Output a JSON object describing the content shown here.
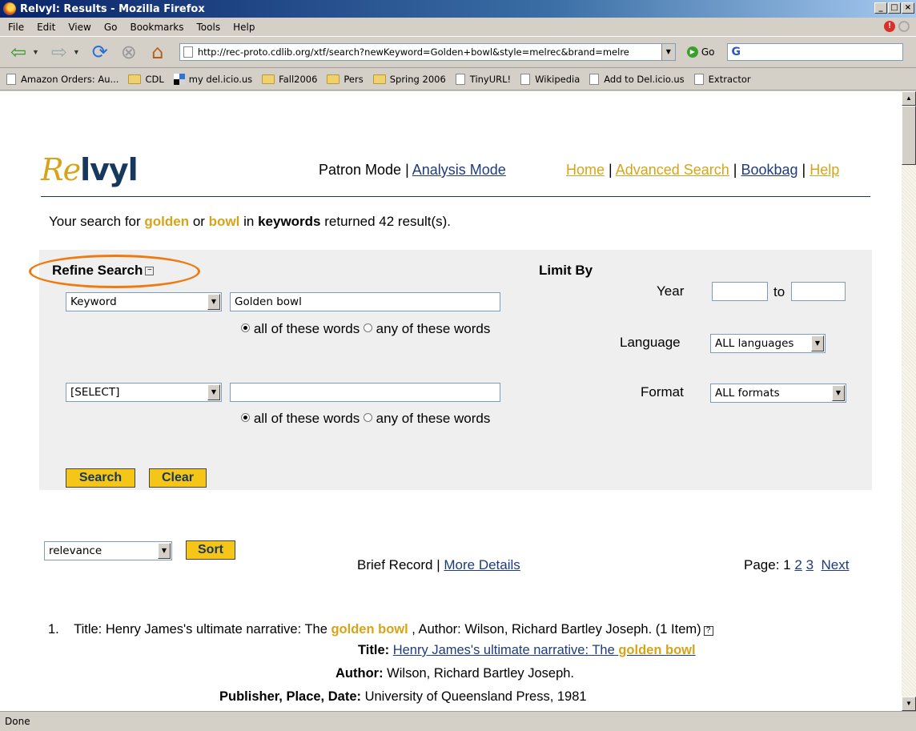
{
  "window": {
    "title": "Relvyl: Results - Mozilla Firefox",
    "controls": [
      "_",
      "□",
      "×"
    ]
  },
  "menu": [
    "File",
    "Edit",
    "View",
    "Go",
    "Bookmarks",
    "Tools",
    "Help"
  ],
  "nav": {
    "url": "http://rec-proto.cdlib.org/xtf/search?newKeyword=Golden+bowl&style=melrec&brand=melre",
    "go_label": "Go",
    "search_glyph": "G"
  },
  "bookmarks": [
    {
      "label": "Amazon Orders: Au...",
      "icon": "page-icon"
    },
    {
      "label": "CDL",
      "icon": "folder-icon"
    },
    {
      "label": "my del.icio.us",
      "icon": "delicious-icon"
    },
    {
      "label": "Fall2006",
      "icon": "folder-icon"
    },
    {
      "label": "Pers",
      "icon": "folder-icon"
    },
    {
      "label": "Spring 2006",
      "icon": "folder-icon"
    },
    {
      "label": "TinyURL!",
      "icon": "page-icon"
    },
    {
      "label": "Wikipedia",
      "icon": "page-icon"
    },
    {
      "label": "Add to Del.icio.us",
      "icon": "page-icon"
    },
    {
      "label": "Extractor",
      "icon": "page-icon"
    }
  ],
  "header": {
    "logo_re": "Re",
    "logo_lvyl": "lvyl",
    "patron_mode": "Patron Mode",
    "sep": " | ",
    "analysis_mode": "Analysis Mode",
    "home": "Home",
    "advanced_search": "Advanced Search",
    "bookbag": "Bookbag",
    "help": "Help"
  },
  "summary": {
    "prefix": "Your search for ",
    "term1": "golden",
    "or": " or ",
    "term2": "bowl",
    "in": " in ",
    "field": "keywords",
    "suffix": " returned 42 result(s)."
  },
  "refine": {
    "title": "Refine Search",
    "collapse_glyph": "−",
    "rows": [
      {
        "field": "Keyword",
        "value": "Golden bowl",
        "opt_all": "all of these words",
        "opt_any": "any of these words"
      },
      {
        "field": "[SELECT]",
        "value": "",
        "opt_all": "all of these words",
        "opt_any": "any of these words"
      }
    ],
    "search_button": "Search",
    "clear_button": "Clear"
  },
  "limit": {
    "title": "Limit By",
    "year_label": "Year",
    "to_label": "to",
    "language_label": "Language",
    "language_value": "ALL languages",
    "format_label": "Format",
    "format_value": "ALL formats"
  },
  "sort": {
    "value": "relevance",
    "button": "Sort"
  },
  "view": {
    "brief": "Brief Record",
    "sep": " | ",
    "more": "More Details"
  },
  "pager": {
    "label": "Page: ",
    "current": "1",
    "p2": "2",
    "p3": "3",
    "next": "Next"
  },
  "result": {
    "num": "1.",
    "line_a": "Title: Henry James's ultimate narrative: The ",
    "hl1": "golden",
    "hl2": "bowl",
    "line_b": " , Author: Wilson, Richard Bartley Joseph.  (1 Item)",
    "help_glyph": "?",
    "title_key": "Title:",
    "title_val_a": "Henry James's ultimate narrative: The ",
    "author_key": "Author:",
    "author_val": " Wilson, Richard Bartley Joseph.",
    "pub_key": "Publisher, Place, Date:",
    "pub_val": " University of Queensland Press, 1981"
  },
  "status": "Done"
}
